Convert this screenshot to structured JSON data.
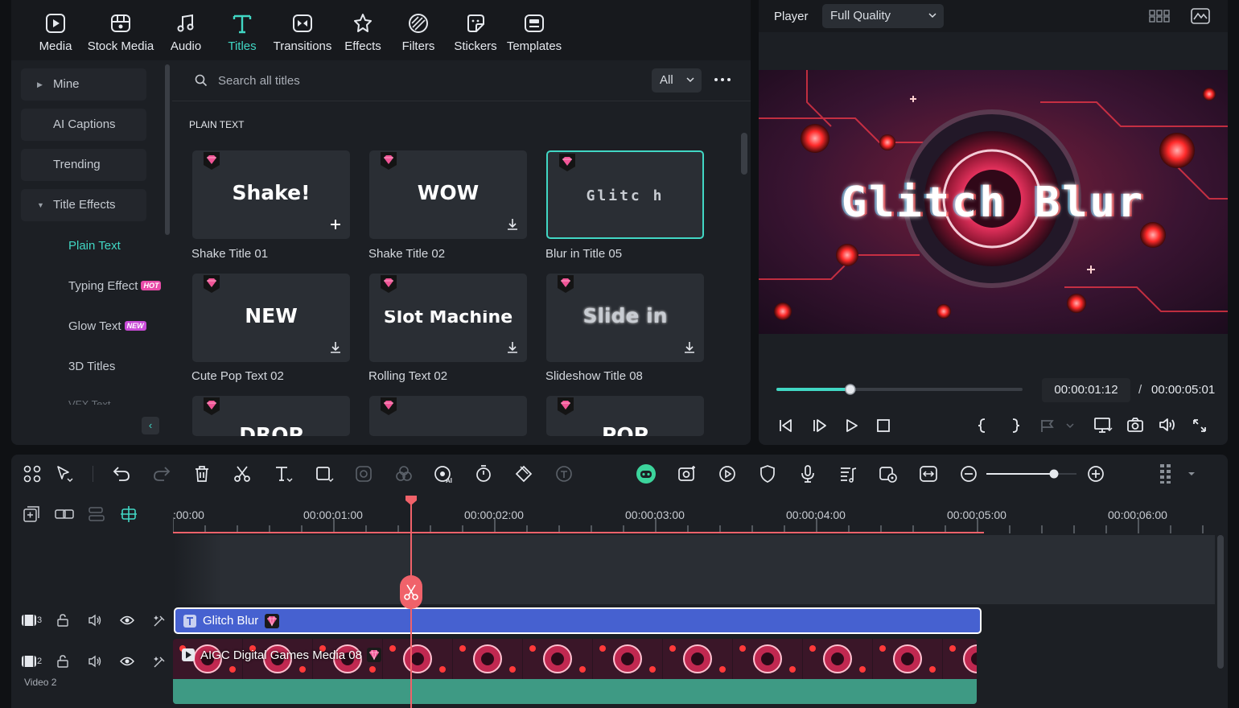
{
  "library": {
    "tabs": [
      {
        "label": "Media",
        "icon": "media-icon"
      },
      {
        "label": "Stock Media",
        "icon": "stock-media-icon"
      },
      {
        "label": "Audio",
        "icon": "audio-icon"
      },
      {
        "label": "Titles",
        "icon": "titles-icon",
        "active": true
      },
      {
        "label": "Transitions",
        "icon": "transitions-icon"
      },
      {
        "label": "Effects",
        "icon": "effects-icon"
      },
      {
        "label": "Filters",
        "icon": "filters-icon"
      },
      {
        "label": "Stickers",
        "icon": "stickers-icon"
      },
      {
        "label": "Templates",
        "icon": "templates-icon"
      }
    ],
    "categories": [
      {
        "label": "Mine"
      },
      {
        "label": "AI Captions"
      },
      {
        "label": "Trending"
      },
      {
        "label": "Title Effects"
      }
    ],
    "subcategories": [
      {
        "label": "Plain Text",
        "active": true,
        "badge": ""
      },
      {
        "label": "Typing Effect",
        "badge": "HOT",
        "badge_color": "#e84ca8"
      },
      {
        "label": "Glow Text",
        "badge": "NEW",
        "badge_color": "#c94bd8"
      },
      {
        "label": "3D Titles",
        "badge": ""
      }
    ],
    "search_placeholder": "Search all titles",
    "filter_value": "All",
    "section_title": "PLAIN TEXT",
    "cards": [
      {
        "name": "Shake Title 01",
        "preview": "Shake!",
        "action": "add"
      },
      {
        "name": "Shake Title 02",
        "preview": "WOW",
        "action": "download"
      },
      {
        "name": "Blur in Title 05",
        "preview": "Glitc h",
        "action": "none",
        "selected": true
      },
      {
        "name": "Cute Pop Text 02",
        "preview": "NEW",
        "action": "download"
      },
      {
        "name": "Rolling Text 02",
        "preview": "Slot Machine",
        "action": "download"
      },
      {
        "name": "Slideshow Title 08",
        "preview": "Slide in",
        "action": "download"
      },
      {
        "name": "",
        "preview": "DROP",
        "action": "none"
      },
      {
        "name": "",
        "preview": "",
        "action": "none"
      },
      {
        "name": "",
        "preview": "POP",
        "action": "none"
      }
    ]
  },
  "player": {
    "title": "Player",
    "quality": "Full Quality",
    "preview_title": "Glitch Blur",
    "timecode_current": "00:00:01:12",
    "timecode_separator": "/",
    "timecode_total": "00:00:05:01",
    "progress": 0.3
  },
  "timeline": {
    "ruler_labels": [
      ":00:00",
      "00:00:01:00",
      "00:00:02:00",
      "00:00:03:00",
      "00:00:04:00",
      "00:00:05:00",
      "00:00:06:00"
    ],
    "title_clip": "Glitch Blur",
    "video_clip": "AIGC Digital Games Media 08",
    "track_title_number": "3",
    "track_video_number": "2",
    "track_video_name": "Video 2",
    "zoom_level": 0.75
  },
  "colors": {
    "accent": "#41d7c4",
    "playhead": "#f0626a",
    "title_clip": "#4661d0",
    "audio_wave": "#3e9a84",
    "premium_gem": "#f05596"
  }
}
